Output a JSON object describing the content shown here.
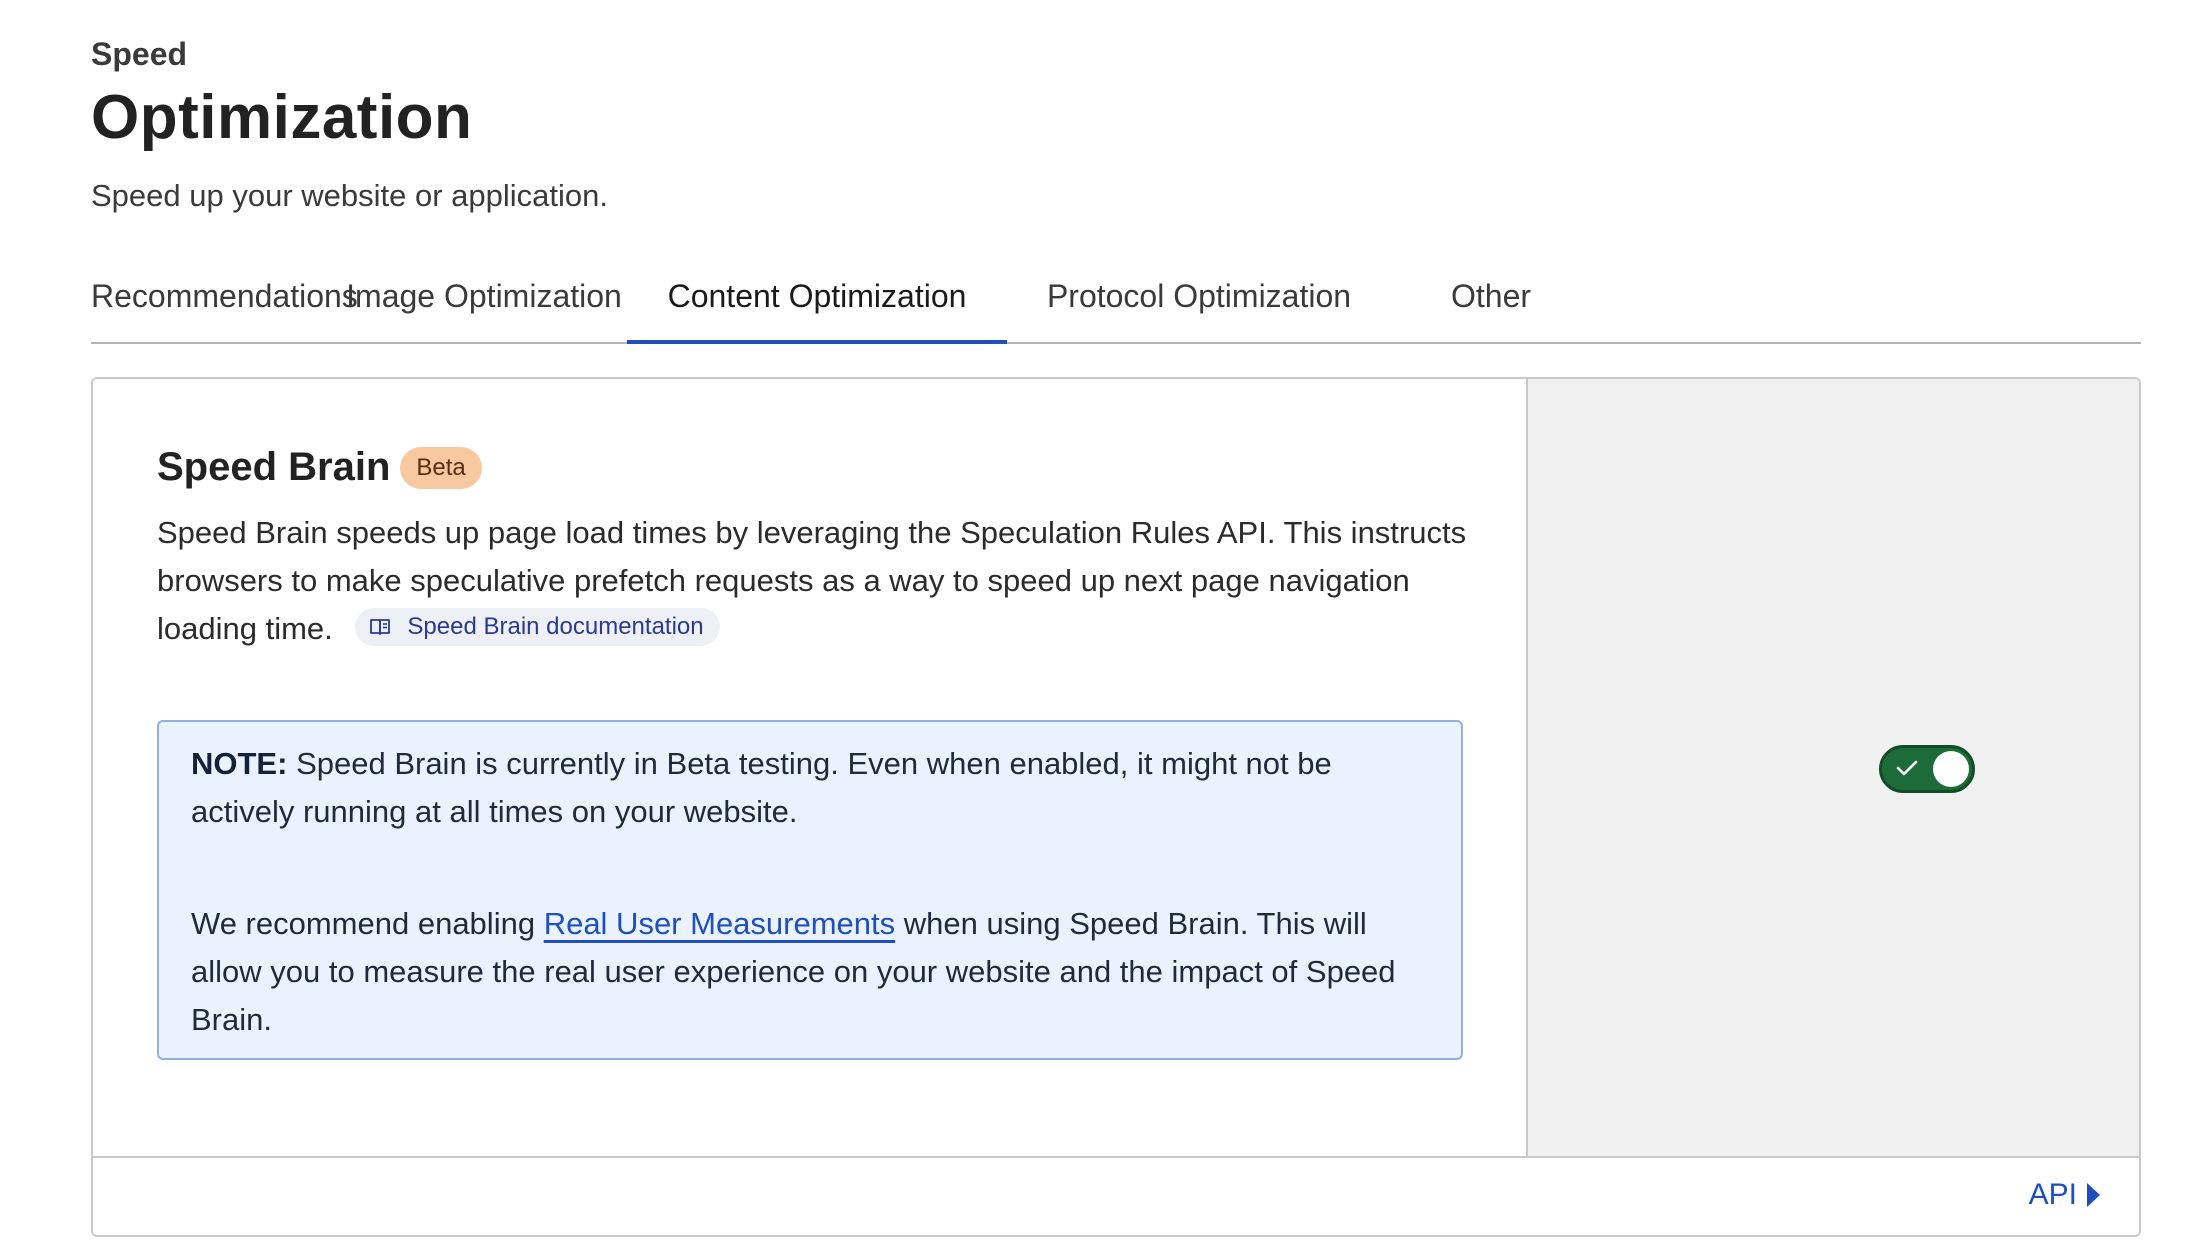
{
  "header": {
    "eyebrow": "Speed",
    "title": "Optimization",
    "subtitle": "Speed up your website or application."
  },
  "tabs": [
    {
      "label": "Recommendations",
      "active": false
    },
    {
      "label": "Image Optimization",
      "active": false
    },
    {
      "label": "Content Optimization",
      "active": true
    },
    {
      "label": "Protocol Optimization",
      "active": false
    },
    {
      "label": "Other",
      "active": false
    }
  ],
  "feature": {
    "title": "Speed Brain",
    "badge": "Beta",
    "description": "Speed Brain speeds up page load times by leveraging the Speculation Rules API. This instructs browsers to make speculative prefetch requests as a way to speed up next page navigation loading time.",
    "doc_link_label": "Speed Brain documentation",
    "doc_link_icon": "book-icon",
    "enabled": true,
    "toggle_icon": "check-icon"
  },
  "note": {
    "label": "NOTE:",
    "text": "Speed Brain is currently in Beta testing. Even when enabled, it might not be actively running at all times on your website.",
    "recommend_prefix": "We recommend enabling",
    "recommend_link": "Real User Measurements",
    "recommend_suffix": "when using Speed Brain. This will allow you to measure the real user experience on your website and the impact of Speed Brain."
  },
  "footer": {
    "api_label": "API",
    "api_icon": "caret-right-icon"
  },
  "colors": {
    "accent": "#1f4fbf",
    "toggle_on": "#1e6b3a",
    "badge_bg": "#f8c8a0",
    "note_bg": "#eaf2fd",
    "note_border": "#8fb0e0"
  }
}
